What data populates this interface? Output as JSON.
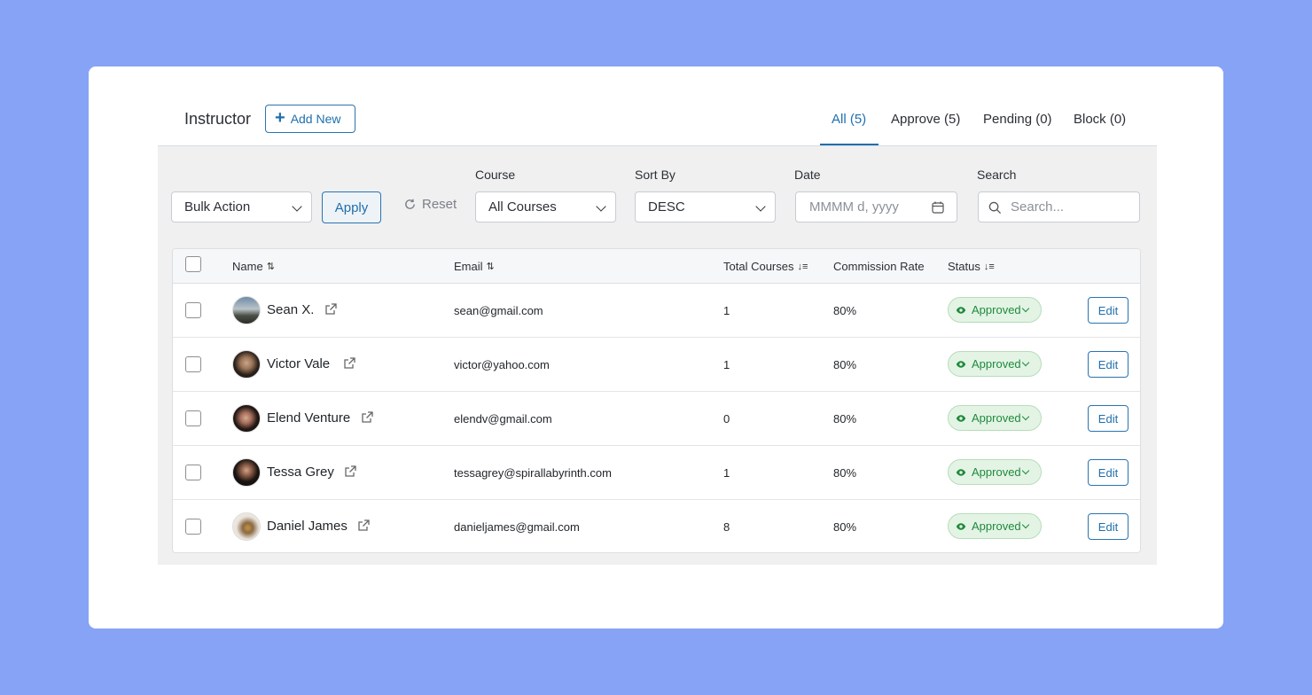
{
  "header": {
    "title": "Instructor",
    "add_new_label": "Add New",
    "tabs": [
      {
        "label": "All (5)",
        "active": true
      },
      {
        "label": "Approve (5)",
        "active": false
      },
      {
        "label": "Pending (0)",
        "active": false
      },
      {
        "label": "Block (0)",
        "active": false
      }
    ]
  },
  "filters": {
    "bulk_action": "Bulk Action",
    "apply_label": "Apply",
    "reset_label": "Reset",
    "course_label": "Course",
    "course_value": "All Courses",
    "sort_label": "Sort By",
    "sort_value": "DESC",
    "date_label": "Date",
    "date_placeholder": "MMMM d, yyyy",
    "search_label": "Search",
    "search_placeholder": "Search..."
  },
  "table": {
    "columns": {
      "name": "Name",
      "email": "Email",
      "total_courses": "Total Courses",
      "commission_rate": "Commission Rate",
      "status": "Status"
    },
    "edit_label": "Edit",
    "rows": [
      {
        "name": "Sean X.",
        "email": "sean@gmail.com",
        "total_courses": "1",
        "commission_rate": "80%",
        "status": "Approved"
      },
      {
        "name": "Victor Vale",
        "email": "victor@yahoo.com",
        "total_courses": "1",
        "commission_rate": "80%",
        "status": "Approved"
      },
      {
        "name": "Elend Venture",
        "email": "elendv@gmail.com",
        "total_courses": "0",
        "commission_rate": "80%",
        "status": "Approved"
      },
      {
        "name": "Tessa Grey",
        "email": "tessagrey@spirallabyrinth.com",
        "total_courses": "1",
        "commission_rate": "80%",
        "status": "Approved"
      },
      {
        "name": "Daniel James",
        "email": "danieljames@gmail.com",
        "total_courses": "8",
        "commission_rate": "80%",
        "status": "Approved"
      }
    ]
  },
  "colors": {
    "background": "#86a3f6",
    "accent": "#1f6fad",
    "status_green": "#1f8a3c",
    "status_bg": "#e3f4e5"
  }
}
